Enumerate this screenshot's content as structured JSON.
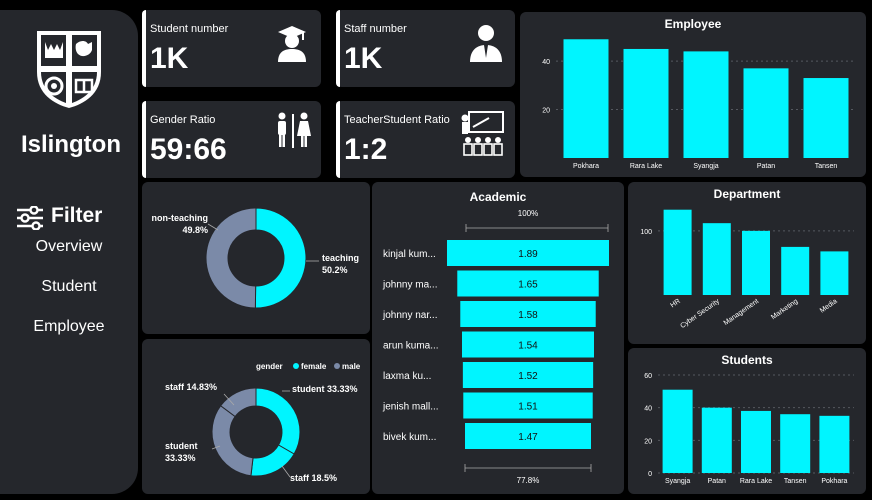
{
  "sidebar": {
    "title": "Islington",
    "filter_label": "Filter",
    "nav": [
      "Overview",
      "Student",
      "Employee"
    ]
  },
  "kpis": {
    "student": {
      "label": "Student number",
      "value": "1K"
    },
    "staff": {
      "label": "Staff number",
      "value": "1K"
    },
    "gender": {
      "label": "Gender Ratio",
      "value": "59:66"
    },
    "ratio": {
      "label": "TeacherStudent Ratio",
      "value": "1:2"
    }
  },
  "colors": {
    "accent": "#00f5ff",
    "slate": "#7b8aa8",
    "panel": "#25272c"
  },
  "chart_data": [
    {
      "id": "employee",
      "type": "bar",
      "title": "Employee",
      "categories": [
        "Pokhara",
        "Rara Lake",
        "Syangja",
        "Patan",
        "Tansen"
      ],
      "values": [
        49,
        45,
        44,
        37,
        33
      ],
      "ylim": [
        0,
        52
      ],
      "yticks": [
        "20",
        "40"
      ],
      "grid": true
    },
    {
      "id": "department",
      "type": "bar",
      "title": "Department",
      "categories": [
        "HR",
        "Cyber Security",
        "Management",
        "Marketing",
        "Media"
      ],
      "values": [
        133,
        112,
        100,
        75,
        68
      ],
      "ylim": [
        0,
        145
      ],
      "yticks": [
        "100"
      ],
      "grid": true
    },
    {
      "id": "students",
      "type": "bar",
      "title": "Students",
      "categories": [
        "Syangja",
        "Patan",
        "Rara Lake",
        "Tansen",
        "Pokhara"
      ],
      "values": [
        51,
        40,
        38,
        36,
        35
      ],
      "ylim": [
        0,
        60
      ],
      "yticks": [
        "0",
        "20",
        "40",
        "60"
      ],
      "grid": true
    },
    {
      "id": "staff-type",
      "type": "pie",
      "labels": [
        "teaching",
        "non-teaching"
      ],
      "display": [
        "50.2%",
        "49.8%"
      ],
      "values": [
        50.2,
        49.8
      ]
    },
    {
      "id": "gender",
      "type": "pie",
      "legend_title": "gender",
      "legend": [
        "female",
        "male"
      ],
      "labels": [
        "student",
        "staff",
        "student",
        "staff"
      ],
      "display": [
        "33.33%",
        "18.5%",
        "33.33%",
        "14.83%"
      ],
      "values": [
        33.33,
        18.5,
        33.33,
        14.83
      ]
    },
    {
      "id": "academic",
      "type": "bar",
      "title": "Academic",
      "top_label": "100%",
      "bottom_label": "77.8%",
      "categories": [
        "kinjal kum...",
        "johnny ma...",
        "johnny nar...",
        "arun kuma...",
        "laxma ku...",
        "jenish mall...",
        "bivek kum..."
      ],
      "values": [
        1.89,
        1.65,
        1.58,
        1.54,
        1.52,
        1.51,
        1.47
      ]
    }
  ]
}
